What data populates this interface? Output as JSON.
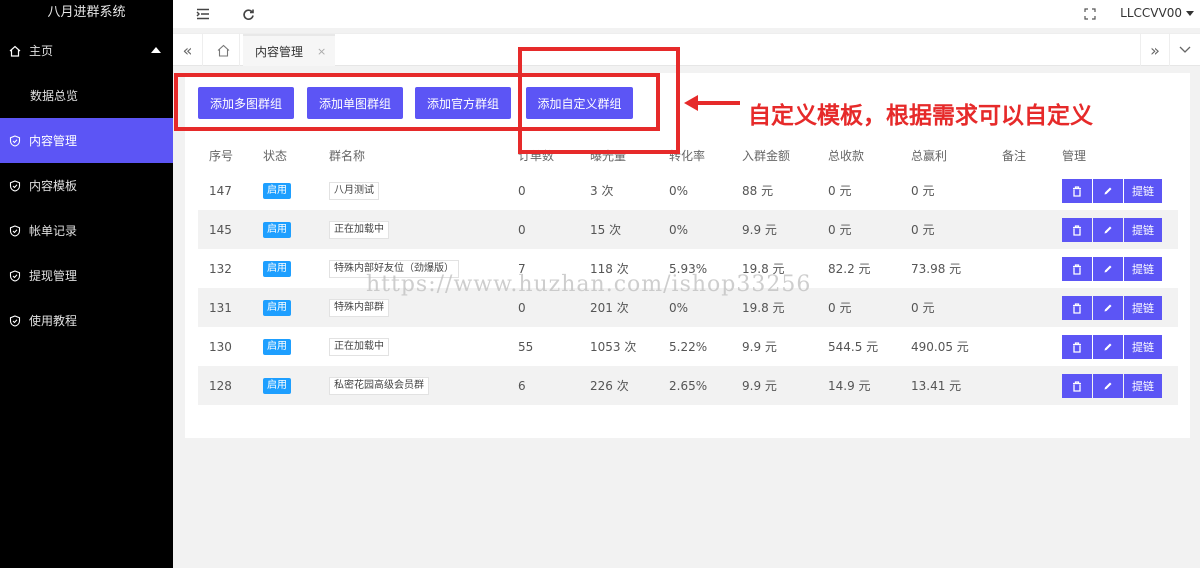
{
  "app": {
    "title": "八月进群系统"
  },
  "sidebar": {
    "items": [
      {
        "label": "主页",
        "icon": "home-icon"
      },
      {
        "label": "数据总览",
        "sub": true
      },
      {
        "label": "内容管理",
        "icon": "shield-check-icon",
        "active": true
      },
      {
        "label": "内容模板",
        "icon": "shield-check-icon"
      },
      {
        "label": "帐单记录",
        "icon": "shield-check-icon"
      },
      {
        "label": "提现管理",
        "icon": "shield-check-icon"
      },
      {
        "label": "使用教程",
        "icon": "shield-check-icon"
      }
    ]
  },
  "header": {
    "user": "LLCCVV00"
  },
  "tabs": [
    {
      "label": "内容管理",
      "close": "×"
    }
  ],
  "toolbar": {
    "add_multi": "添加多图群组",
    "add_single": "添加单图群组",
    "add_official": "添加官方群组",
    "add_custom": "添加自定义群组"
  },
  "annotation": {
    "text": "自定义模板，根据需求可以自定义"
  },
  "watermark": "https://www.huzhan.com/ishop33256",
  "table": {
    "columns": [
      "序号",
      "状态",
      "群名称",
      "订单数",
      "曝光量",
      "转化率",
      "入群金额",
      "总收款",
      "总赢利",
      "备注",
      "管理"
    ],
    "rows": [
      {
        "id": "147",
        "status": "启用",
        "name": "八月测试",
        "orders": "0",
        "exposure": "3 次",
        "rate": "0%",
        "price": "88 元",
        "income": "0 元",
        "profit": "0 元",
        "note": ""
      },
      {
        "id": "145",
        "status": "启用",
        "name": "正在加载中",
        "orders": "0",
        "exposure": "15 次",
        "rate": "0%",
        "price": "9.9 元",
        "income": "0 元",
        "profit": "0 元",
        "note": ""
      },
      {
        "id": "132",
        "status": "启用",
        "name": "特殊内部好友位（劲爆版）",
        "orders": "7",
        "exposure": "118 次",
        "rate": "5.93%",
        "price": "19.8 元",
        "income": "82.2 元",
        "profit": "73.98 元",
        "note": ""
      },
      {
        "id": "131",
        "status": "启用",
        "name": "特殊内部群",
        "orders": "0",
        "exposure": "201 次",
        "rate": "0%",
        "price": "19.8 元",
        "income": "0 元",
        "profit": "0 元",
        "note": ""
      },
      {
        "id": "130",
        "status": "启用",
        "name": "正在加载中",
        "orders": "55",
        "exposure": "1053 次",
        "rate": "5.22%",
        "price": "9.9 元",
        "income": "544.5 元",
        "profit": "490.05 元",
        "note": ""
      },
      {
        "id": "128",
        "status": "启用",
        "name": "私密花园高级会员群",
        "orders": "6",
        "exposure": "226 次",
        "rate": "2.65%",
        "price": "9.9 元",
        "income": "14.9 元",
        "profit": "13.41 元",
        "note": ""
      }
    ],
    "actions": {
      "delete_icon": "trash-icon",
      "edit_icon": "pencil-icon",
      "link_label": "提链"
    }
  },
  "colors": {
    "accent": "#5c55f5",
    "badge": "#1e9fff",
    "annotation": "#e62a2a",
    "sidebar": "#000000"
  }
}
